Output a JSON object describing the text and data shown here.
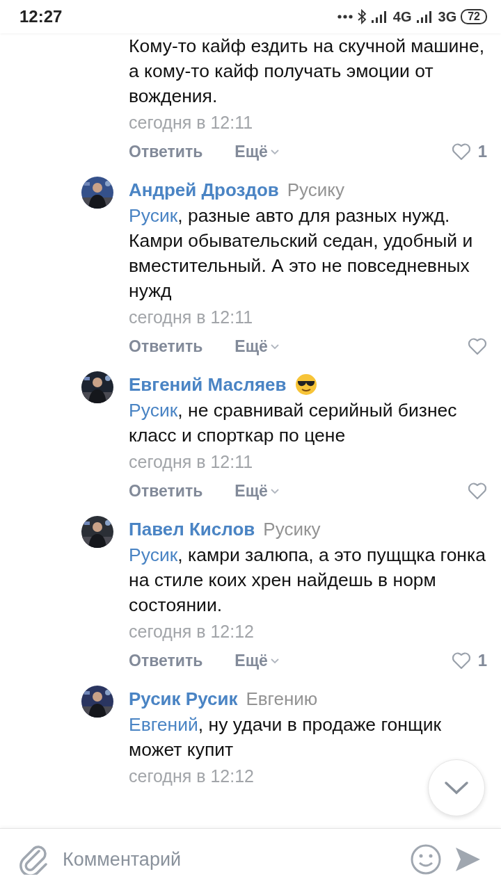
{
  "status_bar": {
    "time": "12:27",
    "network_1": "4G",
    "network_2": "3G",
    "battery": "72"
  },
  "comments": [
    {
      "text": "Кому-то кайф ездить на скучной машине, а кому-то кайф получать эмоции от вождения.",
      "date": "сегодня в 12:11",
      "reply_label": "Ответить",
      "more_label": "Ещё",
      "likes": "1"
    },
    {
      "author": "Андрей Дроздов",
      "reply_to": "Русику",
      "emoji": false,
      "mention": "Русик",
      "text": ", разные авто для разных нужд. Камри обывательский седан, удобный и вместительный. А это не повседневных нужд",
      "date": "сегодня в 12:11",
      "reply_label": "Ответить",
      "more_label": "Ещё"
    },
    {
      "author": "Евгений Масляев",
      "emoji": true,
      "mention": "Русик",
      "text": ", не сравнивай серийный бизнес класс и спорткар по цене",
      "date": "сегодня в 12:11",
      "reply_label": "Ответить",
      "more_label": "Ещё"
    },
    {
      "author": "Павел Кислов",
      "reply_to": "Русику",
      "emoji": false,
      "mention": "Русик",
      "text": ", камри залюпа, а это пущщка гонка на стиле коих хрен найдешь в норм состоянии.",
      "date": "сегодня в 12:12",
      "reply_label": "Ответить",
      "more_label": "Ещё",
      "likes": "1"
    },
    {
      "author": "Русик Русик",
      "reply_to": "Евгению",
      "emoji": false,
      "mention": "Евгений",
      "text": ", ну удачи в продаже гонщик может купит",
      "date": "сегодня в 12:12"
    }
  ],
  "composer": {
    "placeholder": "Комментарий"
  }
}
